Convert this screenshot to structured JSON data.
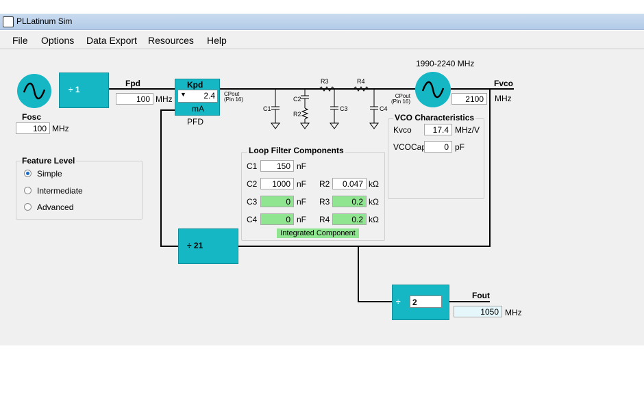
{
  "window": {
    "title": "PLLatinum Sim"
  },
  "menu": [
    "File",
    "Options",
    "Data Export",
    "Resources",
    "Help"
  ],
  "osc": {
    "label": "Fosc",
    "value": "100",
    "unit": "MHz"
  },
  "r_div": {
    "text": "÷ 1"
  },
  "pfd": {
    "fpd_label": "Fpd",
    "fpd_value": "100",
    "fpd_unit": "MHz",
    "kpd_label": "Kpd",
    "kpd_value": "2.4",
    "kpd_unit": "mA",
    "name": "PFD"
  },
  "cpout": {
    "left": "CPout\n(Pin 16)",
    "right": "CPout\n(Pin 16)"
  },
  "filter_parts": {
    "c1": "C1",
    "c2": "C2",
    "r2": "R2",
    "c3": "C3",
    "c4": "C4",
    "r3": "R3",
    "r4": "R4"
  },
  "vco": {
    "range": "1990-2240 MHz",
    "fvco_label": "Fvco",
    "fvco_value": "2100",
    "fvco_unit": "MHz",
    "char_title": "VCO Characteristics",
    "kvco_label": "Kvco",
    "kvco_value": "17.4",
    "kvco_unit": "MHz/V",
    "cap_label": "VCOCap",
    "cap_value": "0",
    "cap_unit": "pF"
  },
  "loop_filter": {
    "title": "Loop Filter Components",
    "c1": {
      "label": "C1",
      "value": "150",
      "unit": "nF"
    },
    "c2": {
      "label": "C2",
      "value": "1000",
      "unit": "nF"
    },
    "c3": {
      "label": "C3",
      "value": "0",
      "unit": "nF"
    },
    "c4": {
      "label": "C4",
      "value": "0",
      "unit": "nF"
    },
    "r2": {
      "label": "R2",
      "value": "0.047",
      "unit": "kΩ"
    },
    "r3": {
      "label": "R3",
      "value": "0.2",
      "unit": "kΩ"
    },
    "r4": {
      "label": "R4",
      "value": "0.2",
      "unit": "kΩ"
    },
    "integrated": "Integrated Component"
  },
  "feature": {
    "title": "Feature Level",
    "options": [
      "Simple",
      "Intermediate",
      "Advanced"
    ],
    "selected": "Simple"
  },
  "n_div": {
    "text": "÷ 21"
  },
  "out_div": {
    "symbol": "÷",
    "value": "2"
  },
  "fout": {
    "label": "Fout",
    "value": "1050",
    "unit": "MHz"
  },
  "colors": {
    "teal": "#15b7c5",
    "green": "#90e690",
    "panel": "#f0f0f0"
  }
}
